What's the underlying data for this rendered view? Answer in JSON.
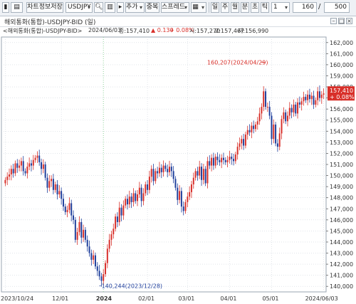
{
  "toolbar": {
    "chart_save_label": "차트정보저장",
    "symbol_value": "USDJPY",
    "add_label": "추가",
    "overlap_label": "중복",
    "spread_label": "스프레드",
    "period_tabs": [
      "일",
      "주",
      "월",
      "분",
      "초",
      "틱"
    ],
    "interval_value": "1",
    "count_value": "160",
    "slash": "/",
    "total_value": "500"
  },
  "window": {
    "title": "해외통화(통합)-USDJPY-BID (일)"
  },
  "info": {
    "series_label": "<해외통화(통합)-USDJPY-BID>",
    "date": "2024/06/03",
    "close_label": "종:157,410",
    "change": "▲ 0.130",
    "change_pct": "+ 0.08%",
    "open_label": "시:157,270",
    "high_label": "고:157,467",
    "low_label": "저:156,990"
  },
  "colors": {
    "up": "#d8302a",
    "down": "#1f3f9c",
    "grid": "#cfd6de",
    "axis_bg": "#ffffff"
  },
  "chart_data": {
    "type": "candlestick",
    "y_range": [
      139.5,
      162.5
    ],
    "y_ticks": [
      140,
      141,
      142,
      143,
      144,
      145,
      146,
      147,
      148,
      149,
      150,
      151,
      152,
      153,
      154,
      155,
      156,
      157,
      158,
      159,
      160,
      161,
      162
    ],
    "y_tick_labels": [
      "140,000",
      "141,000",
      "142,000",
      "143,000",
      "144,000",
      "145,000",
      "146,000",
      "147,000",
      "148,000",
      "149,000",
      "150,000",
      "151,000",
      "152,000",
      "153,000",
      "154,000",
      "155,000",
      "156,000",
      "157,000",
      "158,000",
      "159,000",
      "160,000",
      "161,000",
      "162,000"
    ],
    "x_labels": [
      {
        "label": "2023/10/24",
        "index": 0,
        "bold": false
      },
      {
        "label": "12/01",
        "index": 28,
        "bold": false
      },
      {
        "label": "2024",
        "index": 49,
        "bold": true
      },
      {
        "label": "02/01",
        "index": 71,
        "bold": false
      },
      {
        "label": "03/01",
        "index": 91,
        "bold": false
      },
      {
        "label": "04/01",
        "index": 112,
        "bold": false
      },
      {
        "label": "05/01",
        "index": 133,
        "bold": false
      },
      {
        "label": "2024/06/03",
        "index": 159,
        "bold": false
      }
    ],
    "annotations": [
      {
        "text": "160,207(2024/04/29)",
        "value": 160.207,
        "index": 130
      },
      {
        "text": "140,244(2023/12/28)",
        "value": 140.244,
        "index": 47
      }
    ],
    "last_price_label": "157,410",
    "last_change_label": "+ 0.08%",
    "last_price": 157.41,
    "closes": [
      149.6,
      149.9,
      150.1,
      150.6,
      150.2,
      151.1,
      150.7,
      150.9,
      151.3,
      150.4,
      150.2,
      150.8,
      151.1,
      150.9,
      151.4,
      151.6,
      151.8,
      151.2,
      150.6,
      151.0,
      149.8,
      148.9,
      149.5,
      149.7,
      148.7,
      149.2,
      148.3,
      148.6,
      147.9,
      147.2,
      146.7,
      146.9,
      147.5,
      146.4,
      146.0,
      144.2,
      144.9,
      145.8,
      144.4,
      145.1,
      144.2,
      143.6,
      143.0,
      142.4,
      142.8,
      141.8,
      141.4,
      140.9,
      140.5,
      141.1,
      142.1,
      143.4,
      144.2,
      144.7,
      145.2,
      146.3,
      145.8,
      147.1,
      146.4,
      147.3,
      147.9,
      147.4,
      148.1,
      147.6,
      148.4,
      147.7,
      148.3,
      148.9,
      147.7,
      148.4,
      149.2,
      148.7,
      149.9,
      150.6,
      149.5,
      150.4,
      150.2,
      150.7,
      150.3,
      150.9,
      150.6,
      150.3,
      150.8,
      150.4,
      149.7,
      148.9,
      147.8,
      148.6,
      147.2,
      146.8,
      147.6,
      148.1,
      148.5,
      149.2,
      149.8,
      150.4,
      150.0,
      150.8,
      149.6,
      150.6,
      149.3,
      151.3,
      150.9,
      151.6,
      150.9,
      151.7,
      151.4,
      151.2,
      151.6,
      151.4,
      151.2,
      151.4,
      151.7,
      151.5,
      151.3,
      151.9,
      152.6,
      152.9,
      153.3,
      152.7,
      153.7,
      154.1,
      153.9,
      154.5,
      154.2,
      154.6,
      154.9,
      155.6,
      156.2,
      157.6,
      156.2,
      156.2,
      155.4,
      153.3,
      154.6,
      152.9,
      152.6,
      153.8,
      155.1,
      155.7,
      154.9,
      155.4,
      156.1,
      155.7,
      156.4,
      155.6,
      156.6,
      156.4,
      156.7,
      157.1,
      156.8,
      157.3,
      156.9,
      157.2,
      156.4,
      156.8,
      157.6,
      157.0,
      157.3,
      157.41
    ]
  }
}
